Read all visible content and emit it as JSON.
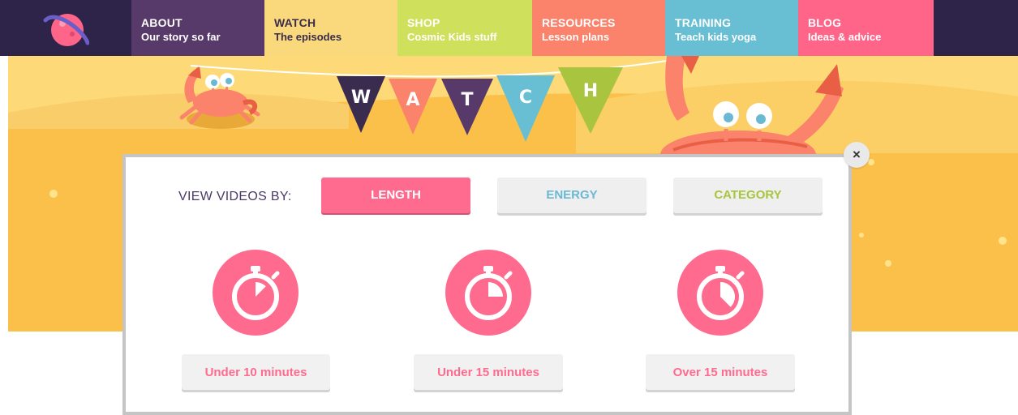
{
  "nav": {
    "items": [
      {
        "title": "ABOUT",
        "subtitle": "Our story so far",
        "bg": "#583a6a",
        "color": "#ffffff"
      },
      {
        "title": "WATCH",
        "subtitle": "The episodes",
        "bg": "#f9d97b",
        "color": "#3a2c4e"
      },
      {
        "title": "SHOP",
        "subtitle": "Cosmic Kids stuff",
        "bg": "#cfe05d",
        "color": "#ffffff"
      },
      {
        "title": "RESOURCES",
        "subtitle": "Lesson plans",
        "bg": "#fb836c",
        "color": "#ffffff"
      },
      {
        "title": "TRAINING",
        "subtitle": "Teach kids yoga",
        "bg": "#68bfd3",
        "color": "#ffffff"
      },
      {
        "title": "BLOG",
        "subtitle": "Ideas & advice",
        "bg": "#ff6589",
        "color": "#ffffff"
      }
    ]
  },
  "banner": {
    "bunting_letters": [
      "W",
      "A",
      "T",
      "C",
      "H"
    ],
    "bunting_colors": [
      "#3a2c4e",
      "#fb836c",
      "#583a6a",
      "#68bfd3",
      "#a9c43e"
    ]
  },
  "modal": {
    "close_label": "×",
    "view_by_label": "VIEW VIDEOS BY:",
    "filters": [
      {
        "label": "LENGTH",
        "color": "#ffffff",
        "active": true
      },
      {
        "label": "ENERGY",
        "color": "#6ab9d2",
        "active": false
      },
      {
        "label": "CATEGORY",
        "color": "#a9c43e",
        "active": false
      }
    ],
    "length_options": [
      {
        "label": "Under 10 minutes",
        "dial_fraction": 0.125
      },
      {
        "label": "Under 15 minutes",
        "dial_fraction": 0.25
      },
      {
        "label": "Over 15 minutes",
        "dial_fraction": 0.375
      }
    ]
  },
  "colors": {
    "accent": "#ff6b8e",
    "nav_bg": "#2e2348",
    "sand": "#fbc04a"
  }
}
